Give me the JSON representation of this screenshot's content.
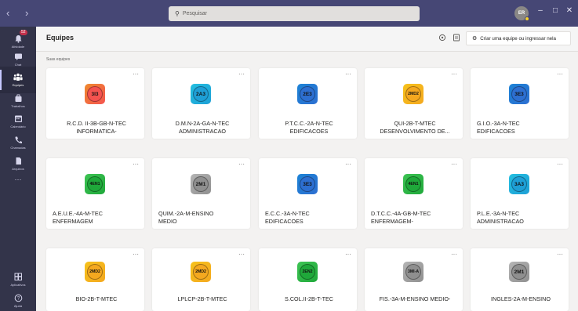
{
  "titlebar": {
    "search_placeholder": "Pesquisar",
    "user_initials": "ER",
    "nav_arrows": "‹ ›",
    "minimize": "–",
    "maximize": "□",
    "close": "✕"
  },
  "rail": {
    "activity": {
      "label": "Atividade",
      "badge": "52"
    },
    "chat": {
      "label": "Chat"
    },
    "teams": {
      "label": "Equipes"
    },
    "assignments": {
      "label": "Trabalhos"
    },
    "calendar": {
      "label": "Calendário"
    },
    "calls": {
      "label": "Chamadas"
    },
    "files": {
      "label": "Arquivos"
    },
    "more": {
      "label": "···"
    },
    "apps": {
      "label": "Aplicativos"
    },
    "help": {
      "label": "Ajuda"
    }
  },
  "header": {
    "title": "Equipes",
    "create_label": "Criar uma equipe ou ingressar nela"
  },
  "section_title": "Suas equipes",
  "cards": [
    {
      "code": "3I3",
      "line1": "R.C.D. II-3B-GB-N-TEC",
      "line2": "INFORMATICA-",
      "align": "center",
      "color_outer": "#ef8a2e",
      "color_inner": "#f4534f"
    },
    {
      "code": "2A3",
      "line1": "D.M.N-2A-GA-N-TEC",
      "line2": "ADMINISTRACAO",
      "align": "center",
      "color_outer": "#24bfe0",
      "color_inner": "#1e9fd6"
    },
    {
      "code": "2E3",
      "line1": "P.T.C.C.-2A-N-TEC",
      "line2": "EDIFICACOES",
      "align": "center",
      "color_outer": "#1c83d6",
      "color_inner": "#2d6fd1"
    },
    {
      "code": "2MD2",
      "line1": "QUI-2B-T-MTEC",
      "line2": "DESENVOLVIMENTO DE...",
      "align": "center",
      "color_outer": "#f6c21c",
      "color_inner": "#f4a81f"
    },
    {
      "code": "3E3",
      "line1": "G.I.O.-3A-N-TEC",
      "line2": "EDIFICACOES",
      "align": "left",
      "color_outer": "#1c83d6",
      "color_inner": "#2d6fd1"
    },
    {
      "code": "4EN1",
      "line1": "A.E.U.E.-4A-M-TEC",
      "line2": "ENFERMAGEM",
      "align": "left",
      "color_outer": "#3ec454",
      "color_inner": "#1fa83a"
    },
    {
      "code": "2M1",
      "line1": "QUIM.-2A-M-ENSINO",
      "line2": "MEDIO",
      "align": "left",
      "color_outer": "#b5b5b5",
      "color_inner": "#8f8f8f"
    },
    {
      "code": "3E3",
      "line1": "E.C.C.-3A-N-TEC",
      "line2": "EDIFICACOES",
      "align": "left",
      "color_outer": "#1c83d6",
      "color_inner": "#2d6fd1"
    },
    {
      "code": "4EN1",
      "line1": "D.T.C.C.-4A-GB-M-TEC",
      "line2": "ENFERMAGEM-",
      "align": "left",
      "color_outer": "#3ec454",
      "color_inner": "#1fa83a"
    },
    {
      "code": "3A3",
      "line1": "P.L.E.-3A-N-TEC",
      "line2": "ADMINISTRACAO",
      "align": "left",
      "color_outer": "#24bfe0",
      "color_inner": "#1e9fd6"
    },
    {
      "code": "2MD2",
      "line1": "BIO-2B-T-MTEC",
      "line2": "",
      "align": "center",
      "color_outer": "#f6c21c",
      "color_inner": "#f4a81f"
    },
    {
      "code": "2MD2",
      "line1": "LPLCP-2B-T-MTEC",
      "line2": "",
      "align": "center",
      "color_outer": "#f6c21c",
      "color_inner": "#f4a81f"
    },
    {
      "code": "2EN2",
      "line1": "S.COL.II-2B-T-TEC",
      "line2": "",
      "align": "center",
      "color_outer": "#3ec454",
      "color_inner": "#1fa83a"
    },
    {
      "code": "3MI-A",
      "line1": "FIS.-3A-M-ENSINO MEDIO-",
      "line2": "",
      "align": "center",
      "color_outer": "#b5b5b5",
      "color_inner": "#8f8f8f"
    },
    {
      "code": "2M1",
      "line1": "INGLES-2A-M-ENSINO",
      "line2": "",
      "align": "center",
      "color_outer": "#b5b5b5",
      "color_inner": "#8f8f8f"
    }
  ],
  "card_more": "···"
}
